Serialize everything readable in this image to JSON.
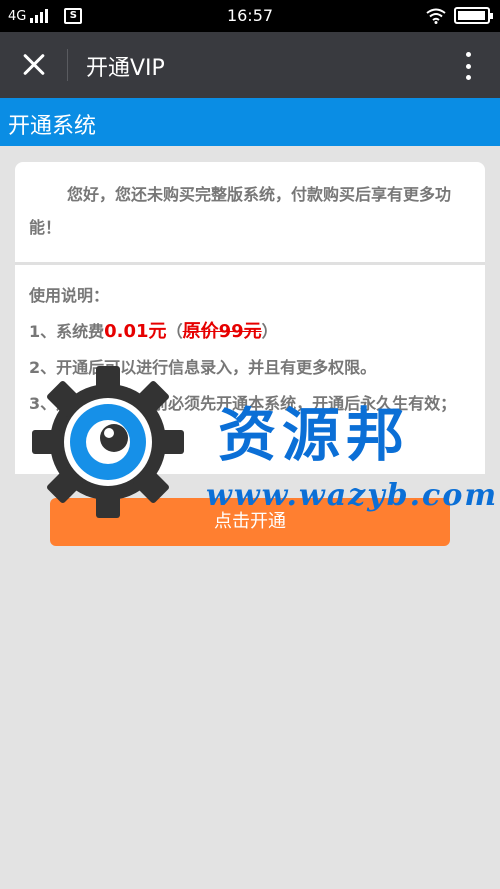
{
  "status_bar": {
    "network": "4G",
    "time": "16:57",
    "icons": [
      "signal-icon",
      "sd-card-icon",
      "wifi-icon",
      "battery-icon"
    ],
    "battery_level": 0.95
  },
  "title_bar": {
    "title": "开通VIP",
    "icons": [
      "close-icon",
      "more-vertical-icon"
    ]
  },
  "section_header": "开通系统",
  "intro_text": "您好，您还未购买完整版系统，付款购买后享有更多功能！",
  "instructions": {
    "heading": "使用说明：",
    "line1_prefix": "1、系统费",
    "line1_price": "0.01元",
    "line1_open": "（",
    "line1_original": "原价99元",
    "line1_close": "）",
    "line2": "2、开通后可以进行信息录入，并且有更多权限。",
    "line3": "3、用户进行借贷前必须先开通本系统，开通后永久生有效；"
  },
  "open_button_label": "点击开通",
  "watermark": {
    "text": "资源邦",
    "url": "www.wazyb.com"
  },
  "colors": {
    "title_bar": "#393a3f",
    "header_blue": "#0a8de4",
    "button_orange": "#ff7f30",
    "price_red": "#e60000",
    "background": "#e3e3e3"
  }
}
